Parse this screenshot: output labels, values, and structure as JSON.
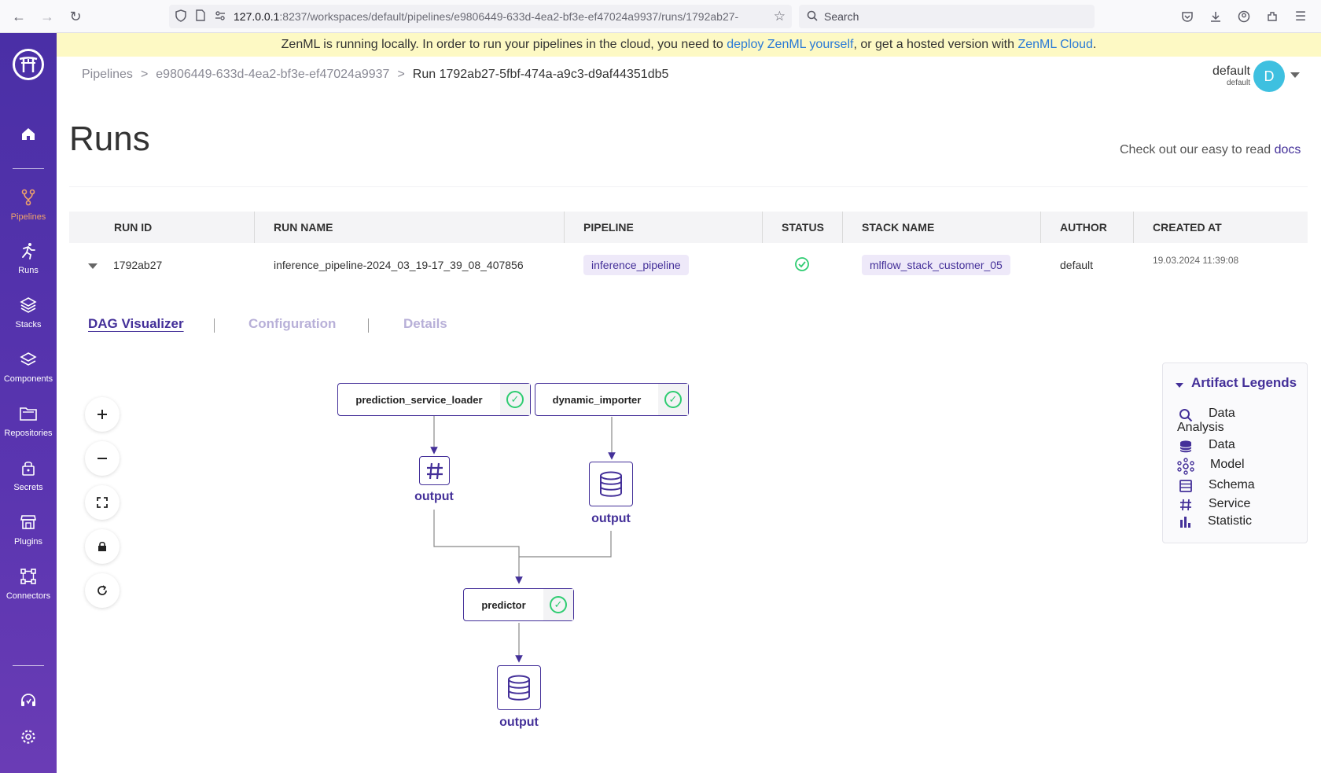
{
  "browser": {
    "url_host": "127.0.0.1",
    "url_rest": ":8237/workspaces/default/pipelines/e9806449-633d-4ea2-bf3e-ef47024a9937/runs/1792ab27-",
    "search_placeholder": "Search"
  },
  "sidebar": {
    "items": [
      {
        "label": "Pipelines",
        "icon": "pipelines-icon"
      },
      {
        "label": "Runs",
        "icon": "runs-icon"
      },
      {
        "label": "Stacks",
        "icon": "stacks-icon"
      },
      {
        "label": "Components",
        "icon": "components-icon"
      },
      {
        "label": "Repositories",
        "icon": "repositories-icon"
      },
      {
        "label": "Secrets",
        "icon": "secrets-icon"
      },
      {
        "label": "Plugins",
        "icon": "plugins-icon"
      },
      {
        "label": "Connectors",
        "icon": "connectors-icon"
      }
    ],
    "active_color": "#f0a36a",
    "bg_color": "#4a2fa6"
  },
  "banner": {
    "text_before": "ZenML is running locally. In order to run your pipelines in the cloud, you need to ",
    "link1": "deploy ZenML yourself",
    "text_middle": ", or get a hosted version with ",
    "link2": "ZenML Cloud",
    "text_after": "."
  },
  "breadcrumb": {
    "item1": "Pipelines",
    "item2": "e9806449-633d-4ea2-bf3e-ef47024a9937",
    "current": "Run 1792ab27-5fbf-474a-a9c3-d9af44351db5",
    "separator": ">"
  },
  "user": {
    "name": "default",
    "workspace": "default",
    "initial": "D"
  },
  "page": {
    "title": "Runs",
    "docs_prefix": "Check out our easy to read ",
    "docs_link": "docs"
  },
  "table": {
    "headers": [
      "RUN ID",
      "RUN NAME",
      "PIPELINE",
      "STATUS",
      "STACK NAME",
      "AUTHOR",
      "CREATED AT"
    ],
    "row": {
      "run_id": "1792ab27",
      "run_name": "inference_pipeline-2024_03_19-17_39_08_407856",
      "pipeline": "inference_pipeline",
      "status": "completed",
      "stack_name": "mlflow_stack_customer_05",
      "author": "default",
      "created_at": "19.03.2024 11:39:08"
    }
  },
  "tabs": [
    {
      "label": "DAG Visualizer",
      "active": true
    },
    {
      "label": "Configuration",
      "active": false
    },
    {
      "label": "Details",
      "active": false
    }
  ],
  "dag": {
    "steps": [
      {
        "name": "prediction_service_loader",
        "status": "completed"
      },
      {
        "name": "dynamic_importer",
        "status": "completed"
      },
      {
        "name": "predictor",
        "status": "completed"
      }
    ],
    "artifacts": [
      {
        "label": "output",
        "type": "Service"
      },
      {
        "label": "output",
        "type": "Data"
      },
      {
        "label": "output",
        "type": "Data"
      }
    ]
  },
  "legend": {
    "title": "Artifact Legends",
    "items": [
      {
        "label": "Data Analysis",
        "icon": "search-icon"
      },
      {
        "label": "Data",
        "icon": "database-icon"
      },
      {
        "label": "Model",
        "icon": "model-icon"
      },
      {
        "label": "Schema",
        "icon": "schema-icon"
      },
      {
        "label": "Service",
        "icon": "hash-icon"
      },
      {
        "label": "Statistic",
        "icon": "bar-chart-icon"
      }
    ]
  },
  "accent_color": "#443099",
  "success_color": "#2ecc71"
}
